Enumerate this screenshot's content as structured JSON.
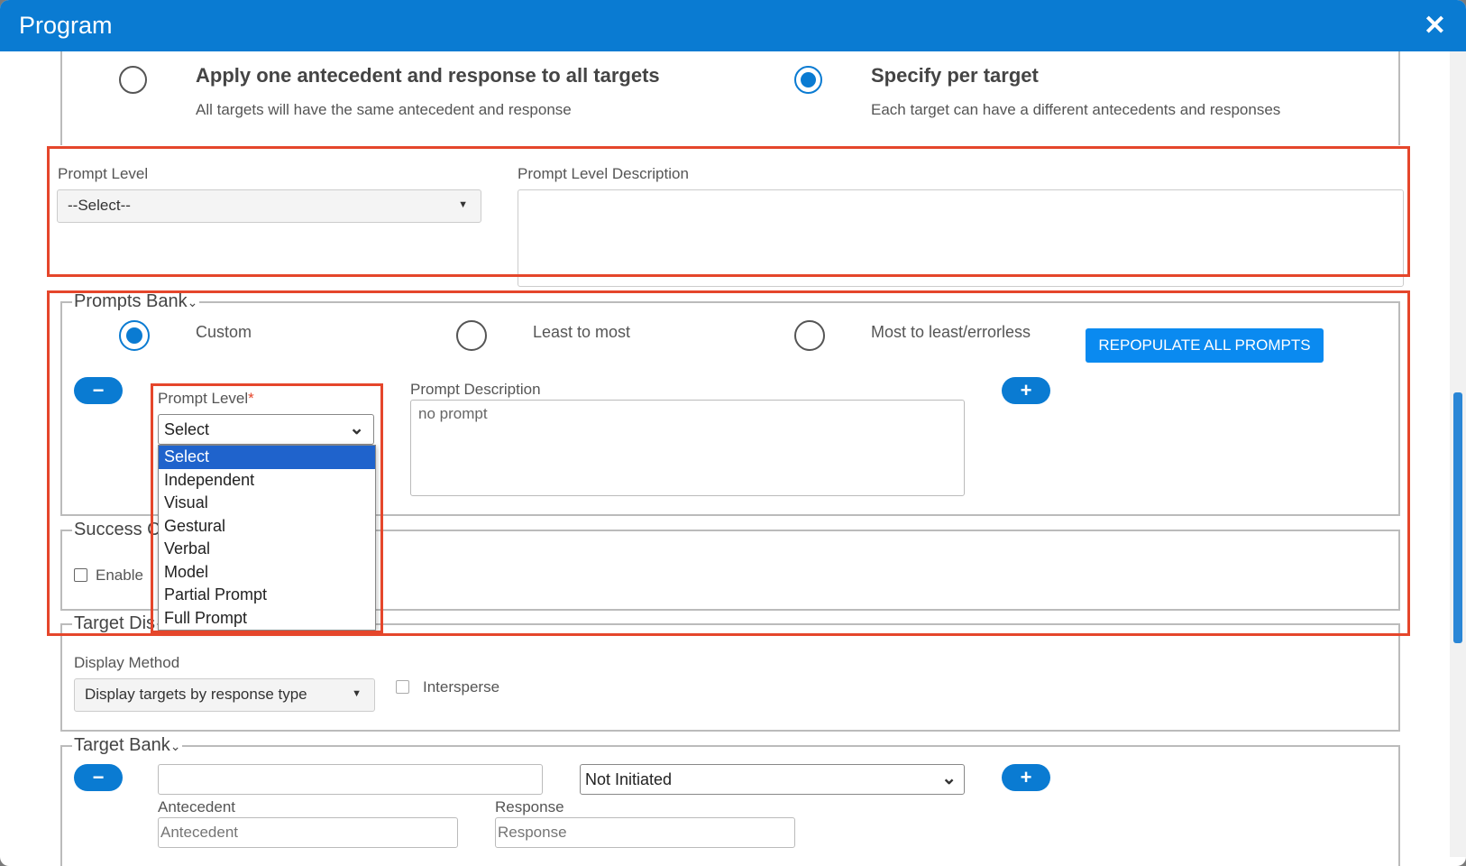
{
  "window": {
    "title": "Program",
    "close_icon": "close-icon"
  },
  "apply_options": {
    "one": {
      "title": "Apply one antecedent and response to all targets",
      "desc": "All targets will have the same antecedent and response",
      "selected": false
    },
    "per_target": {
      "title": "Specify per target",
      "desc": "Each target can have a different antecedents and responses",
      "selected": true
    }
  },
  "prompt_level_section": {
    "label": "Prompt Level",
    "select_value": "--Select--",
    "desc_label": "Prompt Level Description",
    "desc_value": ""
  },
  "prompts_bank": {
    "legend": "Prompts Bank",
    "chevron": "chevron-down-icon",
    "radios": [
      {
        "label": "Custom",
        "selected": true
      },
      {
        "label": "Least to most",
        "selected": false
      },
      {
        "label": "Most to least/errorless",
        "selected": false
      }
    ],
    "repopulate_label": "REPOPULATE ALL PROMPTS",
    "row": {
      "minus_label": "−",
      "plus_label": "+",
      "prompt_level_label": "Prompt Level",
      "required_mark": "*",
      "prompt_level_value": "Select",
      "prompt_desc_label": "Prompt Description",
      "prompt_desc_value": "no prompt",
      "options": [
        "Select",
        "Independent",
        "Visual",
        "Gestural",
        "Verbal",
        "Model",
        "Partial Prompt",
        "Full Prompt"
      ],
      "highlighted_option": "Select"
    }
  },
  "success_criteria": {
    "legend": "Success C",
    "enable_label": "Enable",
    "enabled": false
  },
  "target_display": {
    "legend": "Target Dis",
    "display_method_label": "Display Method",
    "display_method_value": "Display targets by response type",
    "intersperse_label": "Intersperse",
    "intersperse_checked": false
  },
  "target_bank": {
    "legend": "Target Bank",
    "minus_label": "−",
    "plus_label": "+",
    "target_value": "",
    "status_value": "Not Initiated",
    "antecedent_label": "Antecedent",
    "antecedent_placeholder": "Antecedent",
    "response_label": "Response",
    "response_placeholder": "Response"
  },
  "colors": {
    "accent": "#0a7bd2",
    "highlight_red": "#e5462b",
    "option_highlight": "#1f63cc"
  }
}
